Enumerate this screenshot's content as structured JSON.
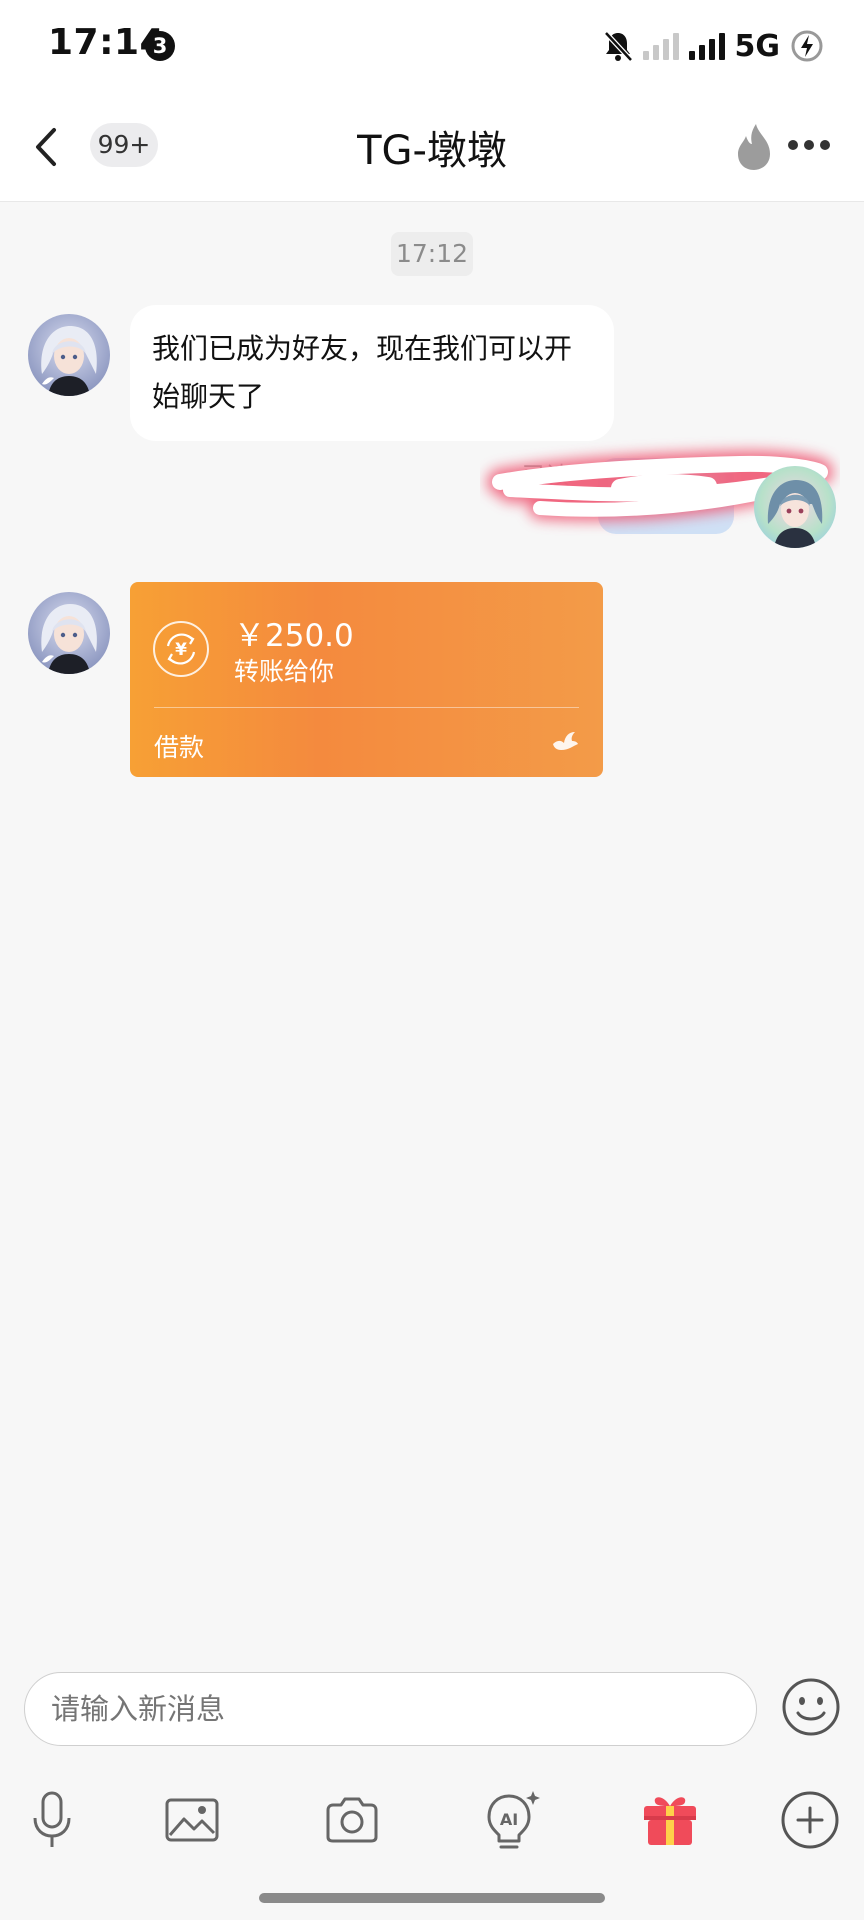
{
  "status": {
    "time": "17:14",
    "notification_count": "3",
    "network": "5G"
  },
  "header": {
    "unread_badge": "99+",
    "title": "TG-墩墩"
  },
  "chat": {
    "timestamp": "17:12",
    "received_message": "我们已成为好友，现在我们可以开始聊天了",
    "sent_status": "已读",
    "transfer": {
      "amount": "￥250.0",
      "subtitle": "转账给你",
      "note": "借款"
    }
  },
  "composer": {
    "placeholder": "请输入新消息"
  },
  "colors": {
    "transfer_start": "#f7a035",
    "transfer_end": "#f39b48",
    "gift_red": "#f04b5a",
    "gift_yellow": "#ffd04a"
  },
  "icons": [
    "back-icon",
    "flame-icon",
    "more-icon",
    "yuan-exchange-icon",
    "bird-icon",
    "emoji-icon",
    "microphone-icon",
    "image-icon",
    "camera-icon",
    "ai-icon",
    "gift-icon",
    "plus-icon"
  ]
}
